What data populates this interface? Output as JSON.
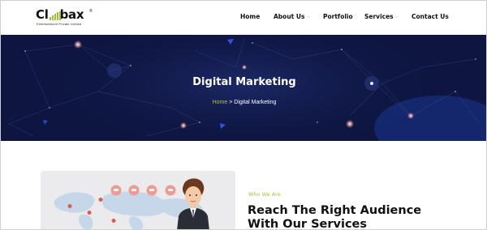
{
  "brand": {
    "name": "Climbax",
    "registered_mark": "®",
    "tagline": "Entertainment Private Limited",
    "bar_color": "#9cc23a"
  },
  "nav": {
    "items": [
      {
        "label": "Home",
        "has_dropdown": false
      },
      {
        "label": "About Us",
        "has_dropdown": true
      },
      {
        "label": "Portfolio",
        "has_dropdown": false
      },
      {
        "label": "Services",
        "has_dropdown": true
      },
      {
        "label": "Contact Us",
        "has_dropdown": false
      }
    ],
    "dropdown_icon": "chevron-down-icon"
  },
  "hero": {
    "title": "Digital Marketing",
    "breadcrumb": {
      "home": "Home",
      "separator": ">",
      "current": "Digital Marketing"
    },
    "background_color": "#0d1540"
  },
  "about": {
    "eyebrow": "Who We Are",
    "headline_line1": "Reach The Right Audience",
    "headline_line2": "With Our Services"
  },
  "colors": {
    "accent": "#a7c63a",
    "text": "#111111"
  }
}
